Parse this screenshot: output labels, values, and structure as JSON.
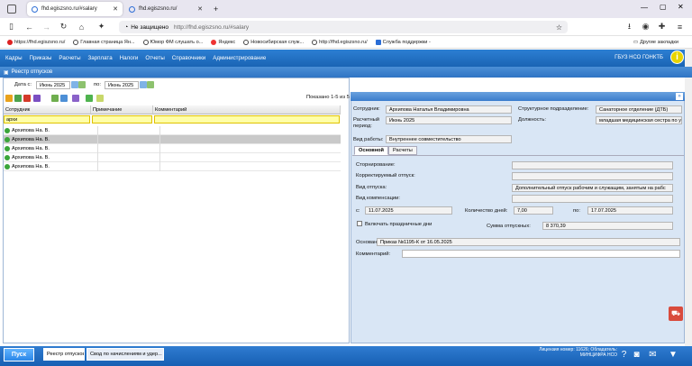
{
  "browser": {
    "tabs": [
      {
        "title": "fhd.egiszsno.ru/#salary",
        "active": true
      },
      {
        "title": "fhd.egiszsno.ru/",
        "active": false
      }
    ],
    "new_tab": "+",
    "security": "Не защищено",
    "url": "http://fhd.egiszsno.ru/#salary",
    "bookmarks": [
      "https://fhd.egiszsno.ru/",
      "Главная страница Ян...",
      "Юмор ФМ слушать о...",
      "Яндекс",
      "Новосибирская служ...",
      "http://fhd.egiszsno.ru/",
      "Служба поддержки -"
    ],
    "other_bookmarks": "Другие закладки"
  },
  "app": {
    "menu": [
      "Кадры",
      "Приказы",
      "Расчеты",
      "Зарплата",
      "Налоги",
      "Отчеты",
      "Справочники",
      "Администрирование"
    ],
    "org": "ГБУЗ НСО ГОНКТБ",
    "window_title": "Реестр отпусков",
    "date_from_label": "Дата с:",
    "date_from": "Июнь 2025",
    "date_to_label": "по:",
    "date_to": "Июнь 2025",
    "shown": "Показано 1-5 из 5",
    "grid": {
      "columns": [
        "Сотрудник",
        "Примечание",
        "Комментарий"
      ],
      "filter_value": "архи",
      "rows": [
        "Архипова На. В.",
        "Архипова На. В.",
        "Архипова На. В.",
        "Архипова На. В.",
        "Архипова На. В."
      ],
      "selected_row": 1
    },
    "detail": {
      "employee_label": "Сотрудник:",
      "employee": "Архипова Наталья Владимировна",
      "period_label": "Расчетный период:",
      "period": "Июнь 2025",
      "work_type_label": "Вид работы:",
      "work_type": "Внутреннее совместительство",
      "dept_label": "Структурное подразделение:",
      "dept": "Санаторное отделение (ДТБ)",
      "position_label": "Должность:",
      "position": "младшая медицинская сестра по у",
      "tabs": [
        "Основной",
        "Расчеты"
      ],
      "storno_label": "Сторнирование:",
      "correcting_label": "Корректируемый отпуск:",
      "vacation_type_label": "Вид отпуска:",
      "vacation_type": "Дополнительный отпуск рабочим и служащим, занятым на рабс",
      "compensation_label": "Вид компенсации:",
      "from_label": "с:",
      "from": "11.07.2025",
      "days_label": "Количество дней:",
      "days": "7,00",
      "to_label": "по:",
      "to": "17.07.2025",
      "holidays_label": "Включать праздничные дни",
      "sum_label": "Сумма отпускных:",
      "sum": "8 370,39",
      "basis_label": "Основание:",
      "basis": "Приказ №1195-К от 16.05.2025",
      "comment_label": "Комментарий:"
    }
  },
  "taskbar": {
    "start": "Пуск",
    "tasks": [
      "Реестр отпусков",
      "Свод по начислениям и удер..."
    ],
    "license_line1": "Лицензия номер: 11626; Обладатель:",
    "license_line2": "МИНЦИФРА НСО"
  }
}
